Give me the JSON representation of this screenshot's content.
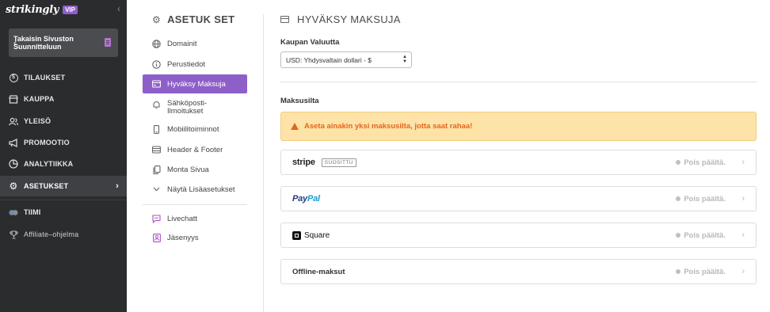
{
  "brand": {
    "logo": "strikingly",
    "badge": "VIP",
    "collapse_icon": "chevron-left-icon"
  },
  "sidebar": {
    "back_label": "Takaisin Sivuston Suunnitteluun",
    "items": [
      {
        "label": "TILAUKSET",
        "icon": "dollar-icon"
      },
      {
        "label": "KAUPPA",
        "icon": "store-icon"
      },
      {
        "label": "YLEISÖ",
        "icon": "audience-icon"
      },
      {
        "label": "PROMOOTIO",
        "icon": "megaphone-icon"
      },
      {
        "label": "ANALYTIIKKA",
        "icon": "pie-chart-icon"
      },
      {
        "label": "ASETUKSET",
        "icon": "gear-icon",
        "active": true
      },
      {
        "label": "TIIMI",
        "icon": "team-icon"
      },
      {
        "label": "Affiliate–ohjelma",
        "icon": "trophy-icon"
      }
    ]
  },
  "settings": {
    "title": "ASETUK SET",
    "items": [
      {
        "label": "Domainit",
        "icon": "globe-icon"
      },
      {
        "label": "Perustiedot",
        "icon": "info-icon"
      },
      {
        "label": "Hyväksy Maksuja",
        "icon": "credit-card-icon",
        "active": true
      },
      {
        "label": "Sähköposti-Ilmoitukset",
        "icon": "bell-icon"
      },
      {
        "label": "Mobiilitoiminnot",
        "icon": "mobile-icon"
      },
      {
        "label": "Header & Footer",
        "icon": "layout-icon"
      },
      {
        "label": "Monta Sivua",
        "icon": "pages-icon"
      },
      {
        "label": "Näytä Lisäasetukset",
        "icon": "chevron-down-icon"
      },
      {
        "label": "Livechatt",
        "icon": "chat-icon"
      },
      {
        "label": "Jäsenyys",
        "icon": "member-icon"
      }
    ]
  },
  "main": {
    "title": "HYVÄKSY MAKSUJA",
    "currency_label": "Kaupan Valuutta",
    "currency_value": "USD: Yhdysvaltain dollari - $",
    "gateways_label": "Maksusilta",
    "warning": "Aseta ainakin yksi maksusilta, jotta saat rahaa!",
    "gateways": [
      {
        "name": "stripe",
        "badge": "SUOSITTU",
        "status": "Pois päältä."
      },
      {
        "name_part1": "Pay",
        "name_part2": "Pal",
        "status": "Pois päältä."
      },
      {
        "name": "Square",
        "status": "Pois päältä."
      },
      {
        "name": "Offline-maksut",
        "status": "Pois päältä."
      }
    ]
  },
  "colors": {
    "accent": "#8e5fc9",
    "sidebar_bg": "#2b2c2e",
    "warning_bg": "#fde3a7",
    "warning_text": "#e4661f"
  }
}
